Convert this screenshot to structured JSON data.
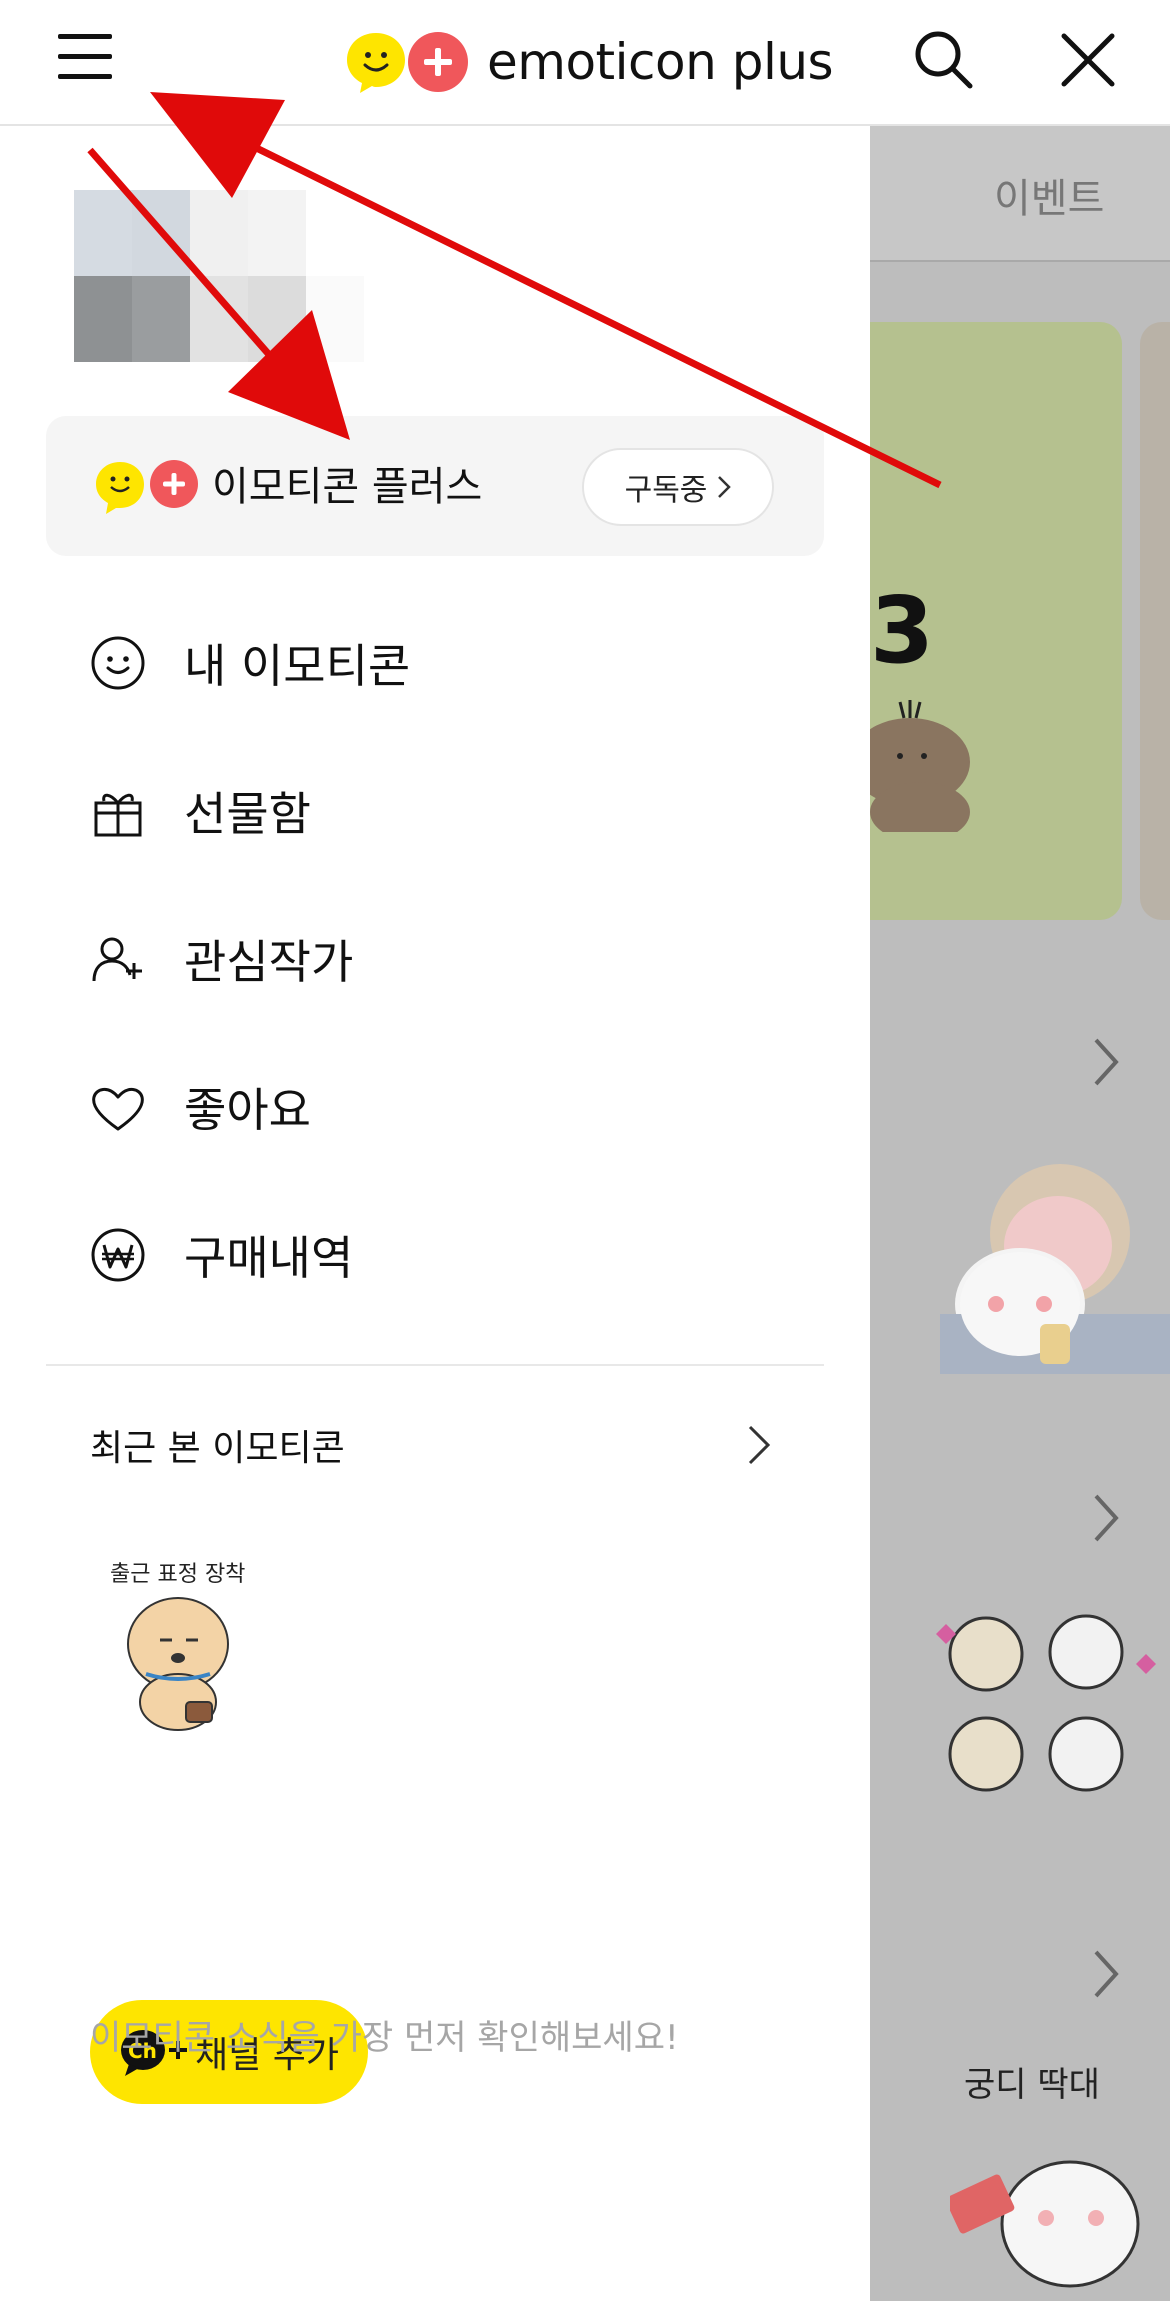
{
  "header": {
    "logo_text": "emoticon plus",
    "menu_icon": "hamburger-menu-icon",
    "search_icon": "search-icon",
    "close_icon": "close-icon"
  },
  "background": {
    "tab_label": "이벤트",
    "card_number": "3"
  },
  "drawer": {
    "plus": {
      "title": "이모티콘 플러스",
      "status_button": "구독중"
    },
    "menu": [
      {
        "label": "내 이모티콘",
        "icon": "smiley-icon"
      },
      {
        "label": "선물함",
        "icon": "gift-icon"
      },
      {
        "label": "관심작가",
        "icon": "add-person-icon"
      },
      {
        "label": "좋아요",
        "icon": "heart-icon"
      },
      {
        "label": "구매내역",
        "icon": "won-currency-icon"
      }
    ],
    "recent": {
      "title": "최근 본 이모티콘",
      "thumb_caption": "출근 표정 장착"
    },
    "channel_button": "채널 추가",
    "notice": "이모티콘 소식을 가장 먼저 확인해보세요!"
  },
  "colors": {
    "brand_yellow": "#fee500",
    "plus_red": "#f0575b",
    "arrow_red": "#e00a0a",
    "overlay_gray": "#bdbdbd"
  }
}
